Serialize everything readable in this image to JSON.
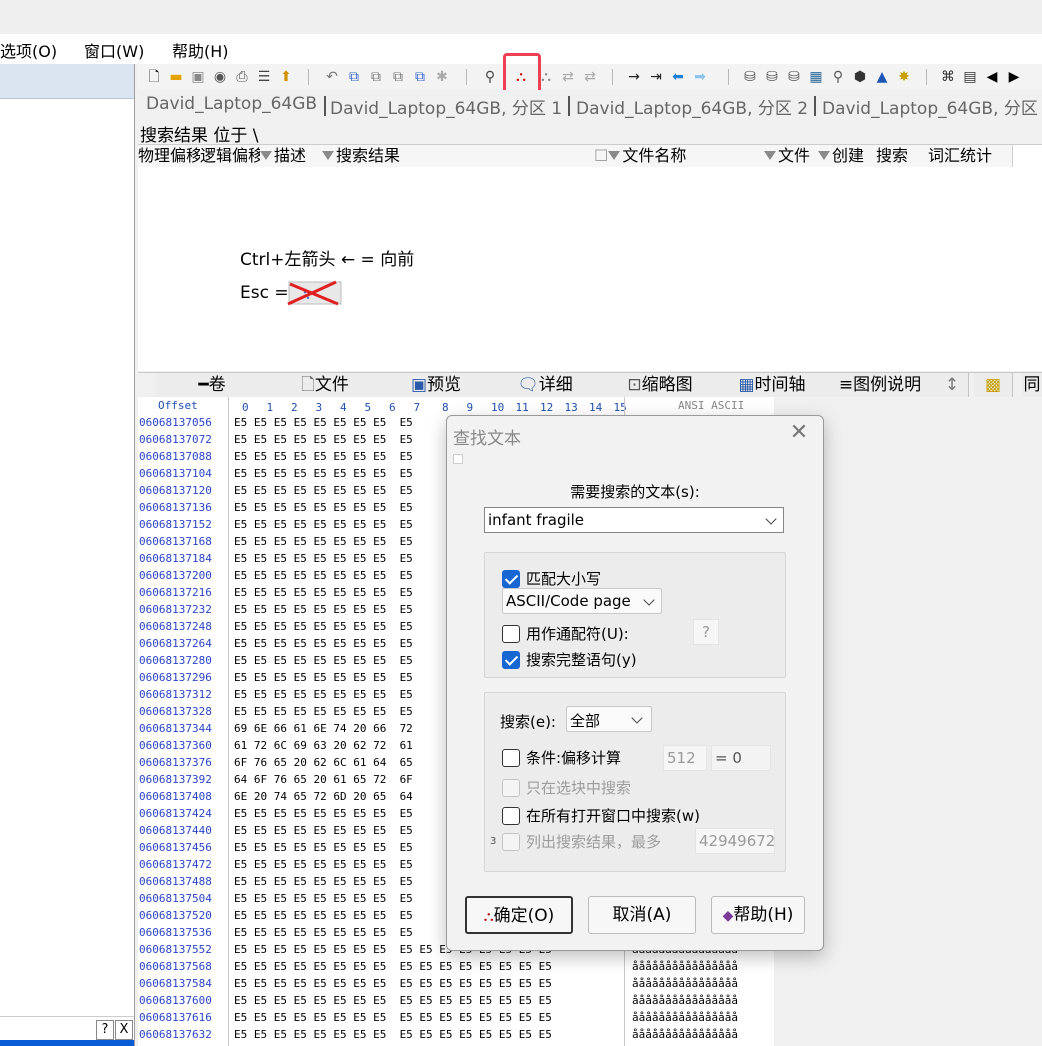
{
  "menu": [
    "选项(O)",
    "窗口(W)",
    "帮助(H)"
  ],
  "colors": {
    "accent": "#1766d2",
    "highlight": "#ee4055",
    "offset_text": "#2a44c8",
    "left_header": "#dbe5f1"
  },
  "toolbar": {
    "icons": [
      "new-file-icon",
      "open-folder-icon",
      "save-icon",
      "open-disk-icon",
      "print-icon",
      "properties-icon",
      "export-icon",
      "undo-icon",
      "copy-icon",
      "cut-icon",
      "paste-icon",
      "paste-special-icon",
      "fill-icon",
      "find-icon",
      "find-text-icon",
      "find-hex-icon",
      "replace-icon",
      "replace-hex-icon",
      "goto-offset-icon",
      "goto-sector-icon",
      "back-icon",
      "forward-icon",
      "disk-icon",
      "disk-edit-icon",
      "disk-tools-icon",
      "ram-icon",
      "search-icon",
      "recover-icon",
      "chart-icon",
      "tools-icon",
      "compare-icon",
      "table-icon",
      "prev-icon",
      "next-icon"
    ]
  },
  "tabs": [
    "David_Laptop_64GB",
    "David_Laptop_64GB, 分区 1",
    "David_Laptop_64GB, 分区 2",
    "David_Laptop_64GB, 分区"
  ],
  "search_location": "搜索结果 位于 \\",
  "results_columns": [
    "物理偏移",
    "逻辑偏移",
    "描述",
    "搜索结果",
    "文件名称",
    "文件",
    "创建",
    "搜索",
    "词汇统计"
  ],
  "hints": {
    "line1": "Ctrl+左箭头 ← = 向前",
    "line2_prefix": "Esc ="
  },
  "bottom_tabs": [
    "卷",
    "文件",
    "预览",
    "详细",
    "缩略图",
    "时间轴",
    "图例说明",
    "↕",
    "同"
  ],
  "hex": {
    "header_offset": "Offset",
    "header_cols": [
      "0",
      "1",
      "2",
      "3",
      "4",
      "5",
      "6",
      "7",
      "8",
      "9",
      "10",
      "11",
      "12",
      "13",
      "14",
      "15"
    ],
    "header_ascii": "ANSI ASCII",
    "rows": [
      {
        "off": "06068137056",
        "hex": "E5 E5 E5 E5 E5 E5 E5 E5  E5",
        "ascii": ""
      },
      {
        "off": "06068137072",
        "hex": "E5 E5 E5 E5 E5 E5 E5 E5  E5",
        "ascii": ""
      },
      {
        "off": "06068137088",
        "hex": "E5 E5 E5 E5 E5 E5 E5 E5  E5",
        "ascii": ""
      },
      {
        "off": "06068137104",
        "hex": "E5 E5 E5 E5 E5 E5 E5 E5  E5",
        "ascii": ""
      },
      {
        "off": "06068137120",
        "hex": "E5 E5 E5 E5 E5 E5 E5 E5  E5",
        "ascii": ""
      },
      {
        "off": "06068137136",
        "hex": "E5 E5 E5 E5 E5 E5 E5 E5  E5",
        "ascii": ""
      },
      {
        "off": "06068137152",
        "hex": "E5 E5 E5 E5 E5 E5 E5 E5  E5",
        "ascii": ""
      },
      {
        "off": "06068137168",
        "hex": "E5 E5 E5 E5 E5 E5 E5 E5  E5",
        "ascii": ""
      },
      {
        "off": "06068137184",
        "hex": "E5 E5 E5 E5 E5 E5 E5 E5  E5",
        "ascii": ""
      },
      {
        "off": "06068137200",
        "hex": "E5 E5 E5 E5 E5 E5 E5 E5  E5",
        "ascii": ""
      },
      {
        "off": "06068137216",
        "hex": "E5 E5 E5 E5 E5 E5 E5 E5  E5",
        "ascii": ""
      },
      {
        "off": "06068137232",
        "hex": "E5 E5 E5 E5 E5 E5 E5 E5  E5",
        "ascii": ""
      },
      {
        "off": "06068137248",
        "hex": "E5 E5 E5 E5 E5 E5 E5 E5  E5",
        "ascii": ""
      },
      {
        "off": "06068137264",
        "hex": "E5 E5 E5 E5 E5 E5 E5 E5  E5",
        "ascii": ""
      },
      {
        "off": "06068137280",
        "hex": "E5 E5 E5 E5 E5 E5 E5 E5  E5",
        "ascii": ""
      },
      {
        "off": "06068137296",
        "hex": "E5 E5 E5 E5 E5 E5 E5 E5  E5",
        "ascii": ""
      },
      {
        "off": "06068137312",
        "hex": "E5 E5 E5 E5 E5 E5 E5 E5  E5",
        "ascii": ""
      },
      {
        "off": "06068137328",
        "hex": "E5 E5 E5 E5 E5 E5 E5 E5  E5",
        "ascii": ""
      },
      {
        "off": "06068137344",
        "hex": "69 6E 66 61 6E 74 20 66  72",
        "ascii": ""
      },
      {
        "off": "06068137360",
        "hex": "61 72 6C 69 63 20 62 72  61",
        "ascii": ""
      },
      {
        "off": "06068137376",
        "hex": "6F 76 65 20 62 6C 61 64  65",
        "ascii": ""
      },
      {
        "off": "06068137392",
        "hex": "64 6F 76 65 20 61 65 72  6F",
        "ascii": ""
      },
      {
        "off": "06068137408",
        "hex": "6E 20 74 65 72 6D 20 65  64",
        "ascii": ""
      },
      {
        "off": "06068137424",
        "hex": "E5 E5 E5 E5 E5 E5 E5 E5  E5",
        "ascii": ""
      },
      {
        "off": "06068137440",
        "hex": "E5 E5 E5 E5 E5 E5 E5 E5  E5",
        "ascii": ""
      },
      {
        "off": "06068137456",
        "hex": "E5 E5 E5 E5 E5 E5 E5 E5  E5",
        "ascii": ""
      },
      {
        "off": "06068137472",
        "hex": "E5 E5 E5 E5 E5 E5 E5 E5  E5",
        "ascii": ""
      },
      {
        "off": "06068137488",
        "hex": "E5 E5 E5 E5 E5 E5 E5 E5  E5",
        "ascii": ""
      },
      {
        "off": "06068137504",
        "hex": "E5 E5 E5 E5 E5 E5 E5 E5  E5",
        "ascii": ""
      },
      {
        "off": "06068137520",
        "hex": "E5 E5 E5 E5 E5 E5 E5 E5  E5",
        "ascii": ""
      },
      {
        "off": "06068137536",
        "hex": "E5 E5 E5 E5 E5 E5 E5 E5  E5",
        "ascii": ""
      },
      {
        "off": "06068137552",
        "hex": "E5 E5 E5 E5 E5 E5 E5 E5  E5 E5 E5 E5 E5 E5 E5 E5",
        "ascii": "åååååååååååååååå"
      },
      {
        "off": "06068137568",
        "hex": "E5 E5 E5 E5 E5 E5 E5 E5  E5 E5 E5 E5 E5 E5 E5 E5",
        "ascii": "åååååååååååååååå"
      },
      {
        "off": "06068137584",
        "hex": "E5 E5 E5 E5 E5 E5 E5 E5  E5 E5 E5 E5 E5 E5 E5 E5",
        "ascii": "åååååååååååååååå"
      },
      {
        "off": "06068137600",
        "hex": "E5 E5 E5 E5 E5 E5 E5 E5  E5 E5 E5 E5 E5 E5 E5 E5",
        "ascii": "åååååååååååååååå"
      },
      {
        "off": "06068137616",
        "hex": "E5 E5 E5 E5 E5 E5 E5 E5  E5 E5 E5 E5 E5 E5 E5 E5",
        "ascii": "åååååååååååååååå"
      },
      {
        "off": "06068137632",
        "hex": "E5 E5 E5 E5 E5 E5 E5 E5  E5 E5 E5 E5 E5 E5 E5 E5",
        "ascii": "åååååååååååååååå"
      }
    ]
  },
  "dialog": {
    "title": "查找文本",
    "search_label": "需要搜索的文本(s):",
    "search_value": "infant fragile",
    "match_case": "匹配大小写",
    "match_case_checked": true,
    "codepage": "ASCII/Code page",
    "wildcard": "用作通配符(U):",
    "wildcard_checked": false,
    "wildcard_char": "?",
    "whole_words": "搜索完整语句(y)",
    "whole_words_checked": true,
    "search_scope_label": "搜索(e):",
    "search_scope_value": "全部",
    "cond_offset": "条件:偏移计算",
    "cond_offset_checked": false,
    "cond_mod": "512",
    "cond_eq": "= 0",
    "only_block": "只在选块中搜索",
    "all_windows": "在所有打开窗口中搜索(w)",
    "all_windows_checked": false,
    "list_results": "列出搜索结果，最多",
    "list_results_num": "42949672",
    "small_prefix": "3",
    "ok": "确定(O)",
    "cancel": "取消(A)",
    "help": "帮助(H)"
  },
  "left_footer": {
    "q": "?",
    "x": "X"
  }
}
